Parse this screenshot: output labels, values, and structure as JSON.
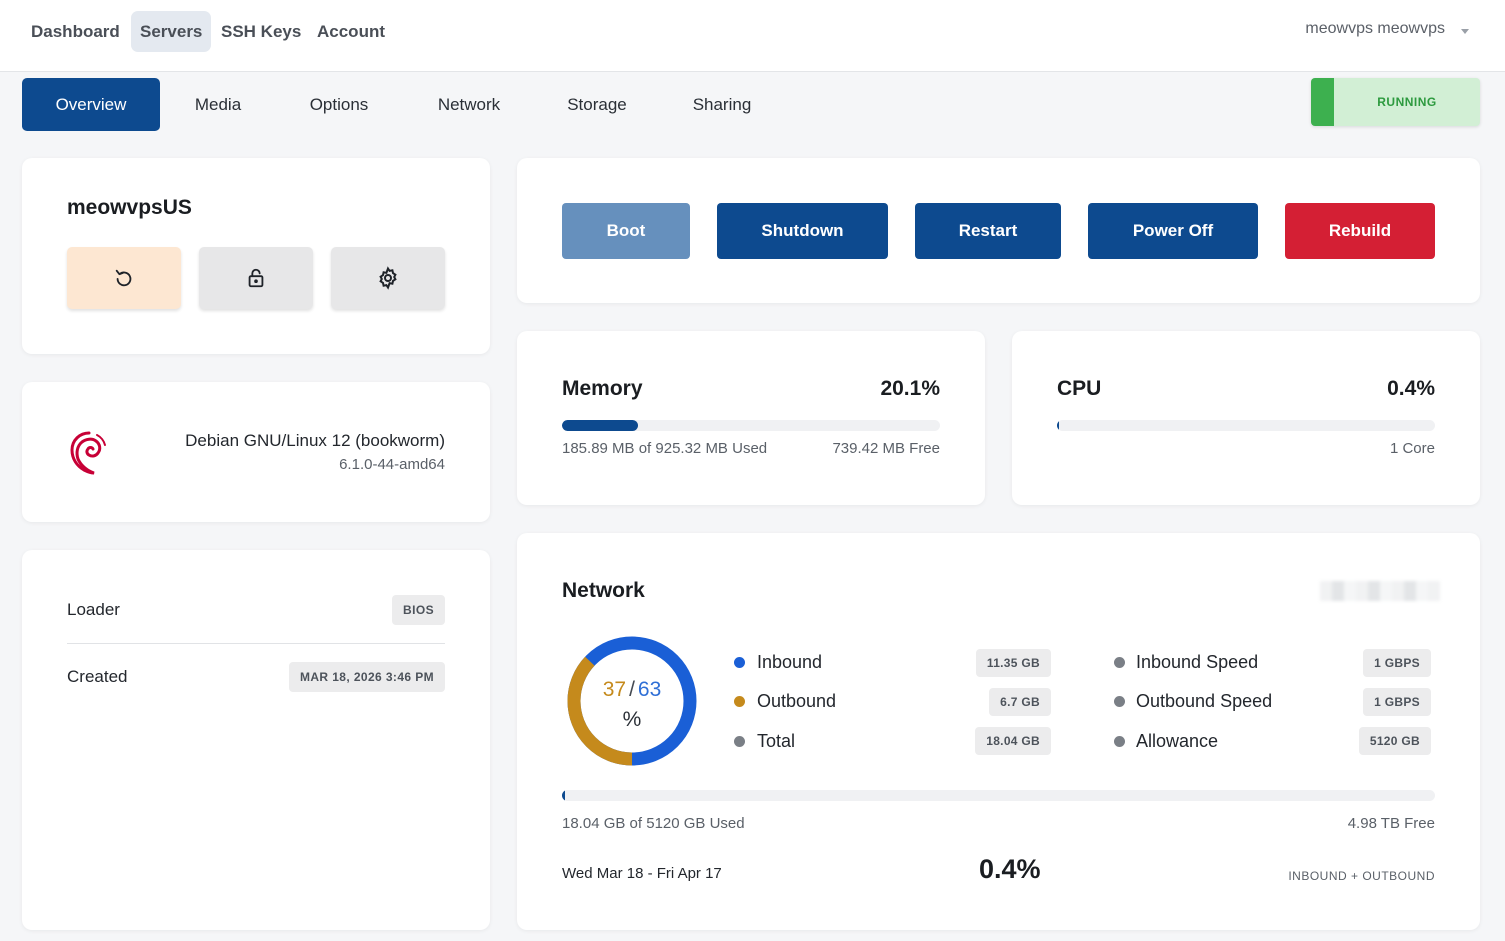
{
  "topnav": {
    "items": [
      {
        "label": "Dashboard"
      },
      {
        "label": "Servers"
      },
      {
        "label": "SSH Keys"
      },
      {
        "label": "Account"
      }
    ],
    "user": "meowvps meowvps"
  },
  "tabs": [
    {
      "label": "Overview"
    },
    {
      "label": "Media"
    },
    {
      "label": "Options"
    },
    {
      "label": "Network"
    },
    {
      "label": "Storage"
    },
    {
      "label": "Sharing"
    }
  ],
  "status": {
    "label": "RUNNING",
    "color": "#3db04f"
  },
  "server": {
    "name": "meowvpsUS"
  },
  "os": {
    "name": "Debian GNU/Linux 12 (bookworm)",
    "kernel": "6.1.0-44-amd64"
  },
  "info": {
    "loader_label": "Loader",
    "loader_value": "BIOS",
    "created_label": "Created",
    "created_value": "MAR 18, 2026 3:46 PM"
  },
  "actions": {
    "boot": "Boot",
    "shutdown": "Shutdown",
    "restart": "Restart",
    "power_off": "Power Off",
    "rebuild": "Rebuild"
  },
  "memory": {
    "title": "Memory",
    "percent": "20.1%",
    "fill": 0.201,
    "used_text": "185.89 MB of 925.32 MB Used",
    "free_text": "739.42 MB Free"
  },
  "cpu": {
    "title": "CPU",
    "percent": "0.4%",
    "fill": 0.004,
    "cores": "1 Core"
  },
  "network": {
    "title": "Network",
    "donut": {
      "inbound": "37",
      "sep": "/",
      "outbound": "63",
      "unit": "%"
    },
    "legend": {
      "inbound": "Inbound",
      "inbound_value": "11.35 GB",
      "outbound": "Outbound",
      "outbound_value": "6.7 GB",
      "total": "Total",
      "total_value": "18.04 GB",
      "inbound_speed": "Inbound Speed",
      "inbound_speed_value": "1 GBPS",
      "outbound_speed": "Outbound Speed",
      "outbound_speed_value": "1 GBPS",
      "allowance": "Allowance",
      "allowance_value": "5120 GB"
    },
    "fill": 0.004,
    "used_text": "18.04 GB of 5120 GB Used",
    "free_text": "4.98 TB Free",
    "period": "Wed Mar 18 - Fri Apr 17",
    "percent": "0.4%",
    "direction": "INBOUND + OUTBOUND"
  },
  "colors": {
    "primary": "#0d4a8f",
    "danger": "#d41f34",
    "boot": "#6690bd",
    "inbound": "#1a5fd6",
    "outbound": "#c58a1c",
    "neutral": "#7a7f86"
  }
}
